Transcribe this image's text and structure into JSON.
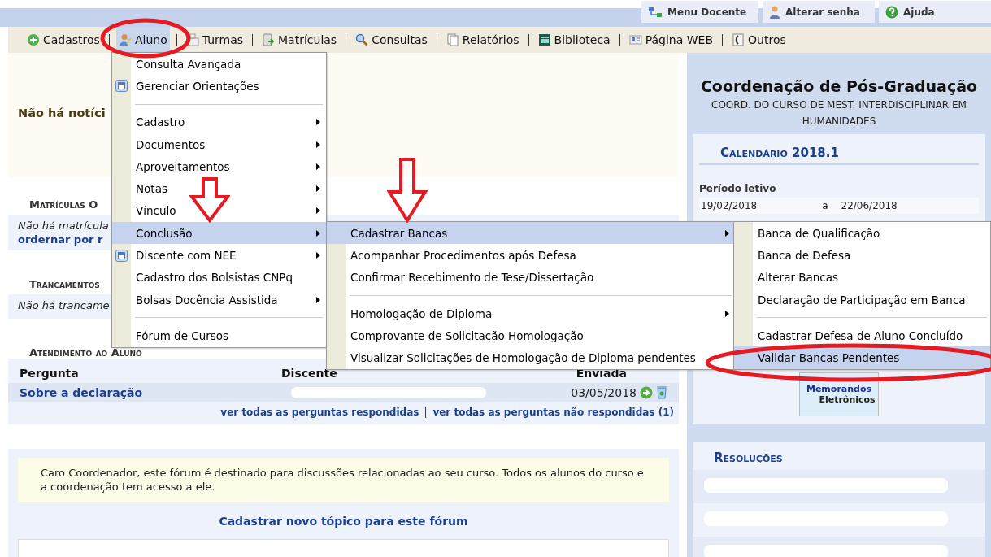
{
  "top_links": [
    {
      "label": "Menu Docente"
    },
    {
      "label": "Alterar senha"
    },
    {
      "label": "Ajuda"
    }
  ],
  "menubar": [
    {
      "label": "Cadastros",
      "selected": false
    },
    {
      "label": "Aluno",
      "selected": true
    },
    {
      "label": "Turmas",
      "selected": false
    },
    {
      "label": "Matrículas",
      "selected": false
    },
    {
      "label": "Consultas",
      "selected": false
    },
    {
      "label": "Relatórios",
      "selected": false
    },
    {
      "label": "Biblioteca",
      "selected": false
    },
    {
      "label": "Página WEB",
      "selected": false
    },
    {
      "label": "Outros",
      "selected": false
    }
  ],
  "news": {
    "text": "Não há notíci"
  },
  "matriculas": {
    "heading": "Matrículas O",
    "empty": "Não há matrícula",
    "link": "ordernar por r"
  },
  "trancamentos": {
    "heading": "Trancamentos",
    "empty": "Não há trancame"
  },
  "atendimento": {
    "heading": "Atendimento ao Aluno",
    "columns": [
      "Pergunta",
      "Discente",
      "Enviada"
    ],
    "rows": [
      {
        "pergunta": "Sobre a declaração",
        "enviada": "03/05/2018"
      }
    ],
    "links": [
      "ver todas as perguntas respondidas",
      "ver todas as perguntas não respondidas (1)"
    ]
  },
  "forum": {
    "notice": "Caro Coordenador, este fórum é destinado para discussões relacionadas ao seu curso. Todos os alunos do curso e a coordenação tem acesso a ele.",
    "link": "Cadastrar novo tópico para este fórum"
  },
  "sidebar": {
    "title": "Coordenação de Pós-Graduação",
    "subtitle": "COORD. DO CURSO DE MEST. INTERDISCIPLINAR EM HUMANIDADES",
    "calendar": {
      "heading": "Calendário 2018.1",
      "period_label": "Período letivo",
      "start": "19/02/2018",
      "sep": "a",
      "end": "22/06/2018"
    },
    "memorandos": [
      "Memorandos",
      "Eletrônicos"
    ],
    "resolucoes": {
      "heading": "Resoluções"
    }
  },
  "menus": [
    {
      "items": [
        {
          "kind": "item",
          "label": "Consulta Avançada",
          "submenu": false,
          "selected": false
        },
        {
          "kind": "icon-item",
          "label": "Gerenciar Orientações",
          "submenu": false,
          "selected": false
        },
        {
          "kind": "separator"
        },
        {
          "kind": "item",
          "label": "Cadastro",
          "submenu": true,
          "selected": false
        },
        {
          "kind": "item",
          "label": "Documentos",
          "submenu": true,
          "selected": false
        },
        {
          "kind": "item",
          "label": "Aproveitamentos",
          "submenu": true,
          "selected": false
        },
        {
          "kind": "item",
          "label": "Notas",
          "submenu": true,
          "selected": false
        },
        {
          "kind": "item",
          "label": "Vínculo",
          "submenu": true,
          "selected": false
        },
        {
          "kind": "item",
          "label": "Conclusão",
          "submenu": true,
          "selected": true
        },
        {
          "kind": "icon-item",
          "label": "Discente com NEE",
          "submenu": true,
          "selected": false
        },
        {
          "kind": "item",
          "label": "Cadastro dos Bolsistas CNPq",
          "submenu": false,
          "selected": false
        },
        {
          "kind": "item",
          "label": "Bolsas Docência Assistida",
          "submenu": true,
          "selected": false
        },
        {
          "kind": "separator"
        },
        {
          "kind": "item",
          "label": "Fórum de Cursos",
          "submenu": false,
          "selected": false
        }
      ]
    },
    {
      "items": [
        {
          "kind": "item",
          "label": "Cadastrar Bancas",
          "submenu": true,
          "selected": true
        },
        {
          "kind": "item",
          "label": "Acompanhar Procedimentos após Defesa",
          "submenu": false,
          "selected": false
        },
        {
          "kind": "item",
          "label": "Confirmar Recebimento de Tese/Dissertação",
          "submenu": false,
          "selected": false
        },
        {
          "kind": "separator"
        },
        {
          "kind": "item",
          "label": "Homologação de Diploma",
          "submenu": true,
          "selected": false
        },
        {
          "kind": "item",
          "label": "Comprovante de Solicitação Homologação",
          "submenu": false,
          "selected": false
        },
        {
          "kind": "item",
          "label": "Visualizar Solicitações de Homologação de Diploma pendentes",
          "submenu": false,
          "selected": false
        }
      ]
    },
    {
      "items": [
        {
          "kind": "item",
          "label": "Banca de Qualificação",
          "submenu": false,
          "selected": false
        },
        {
          "kind": "item",
          "label": "Banca de Defesa",
          "submenu": false,
          "selected": false
        },
        {
          "kind": "item",
          "label": "Alterar Bancas",
          "submenu": false,
          "selected": false
        },
        {
          "kind": "item",
          "label": "Declaração de Participação em Banca",
          "submenu": false,
          "selected": false
        },
        {
          "kind": "separator"
        },
        {
          "kind": "item",
          "label": "Cadastrar Defesa de Aluno Concluído",
          "submenu": false,
          "selected": false
        },
        {
          "kind": "item",
          "label": "Validar Bancas Pendentes",
          "submenu": false,
          "selected": true
        }
      ]
    }
  ]
}
